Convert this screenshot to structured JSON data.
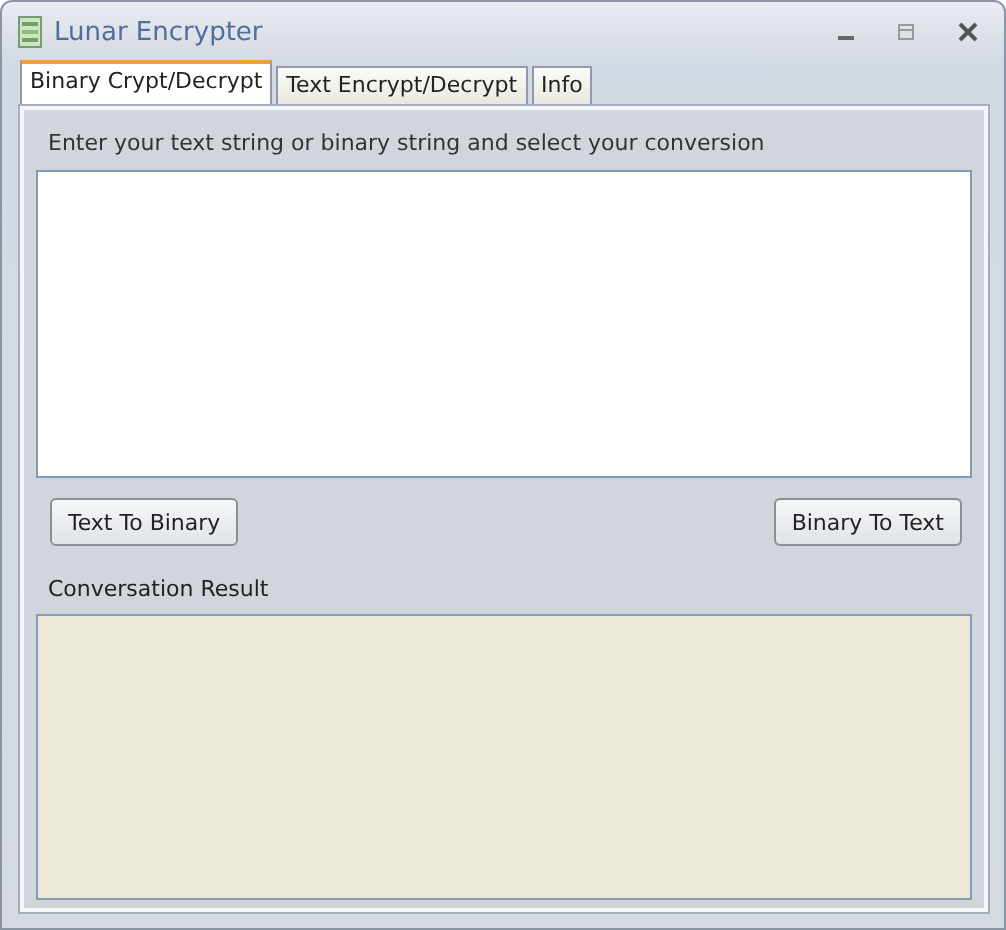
{
  "window": {
    "title": "Lunar Encrypter"
  },
  "tabs": [
    {
      "label": "Binary Crypt/Decrypt",
      "selected": true
    },
    {
      "label": "Text Encrypt/Decrypt",
      "selected": false
    },
    {
      "label": "Info",
      "selected": false
    }
  ],
  "instruction": "Enter your text string or binary string and select your conversion",
  "buttons": [
    {
      "label": "Text To Binary"
    },
    {
      "label": "Binary To Text"
    }
  ],
  "result_label": "Conversation Result"
}
